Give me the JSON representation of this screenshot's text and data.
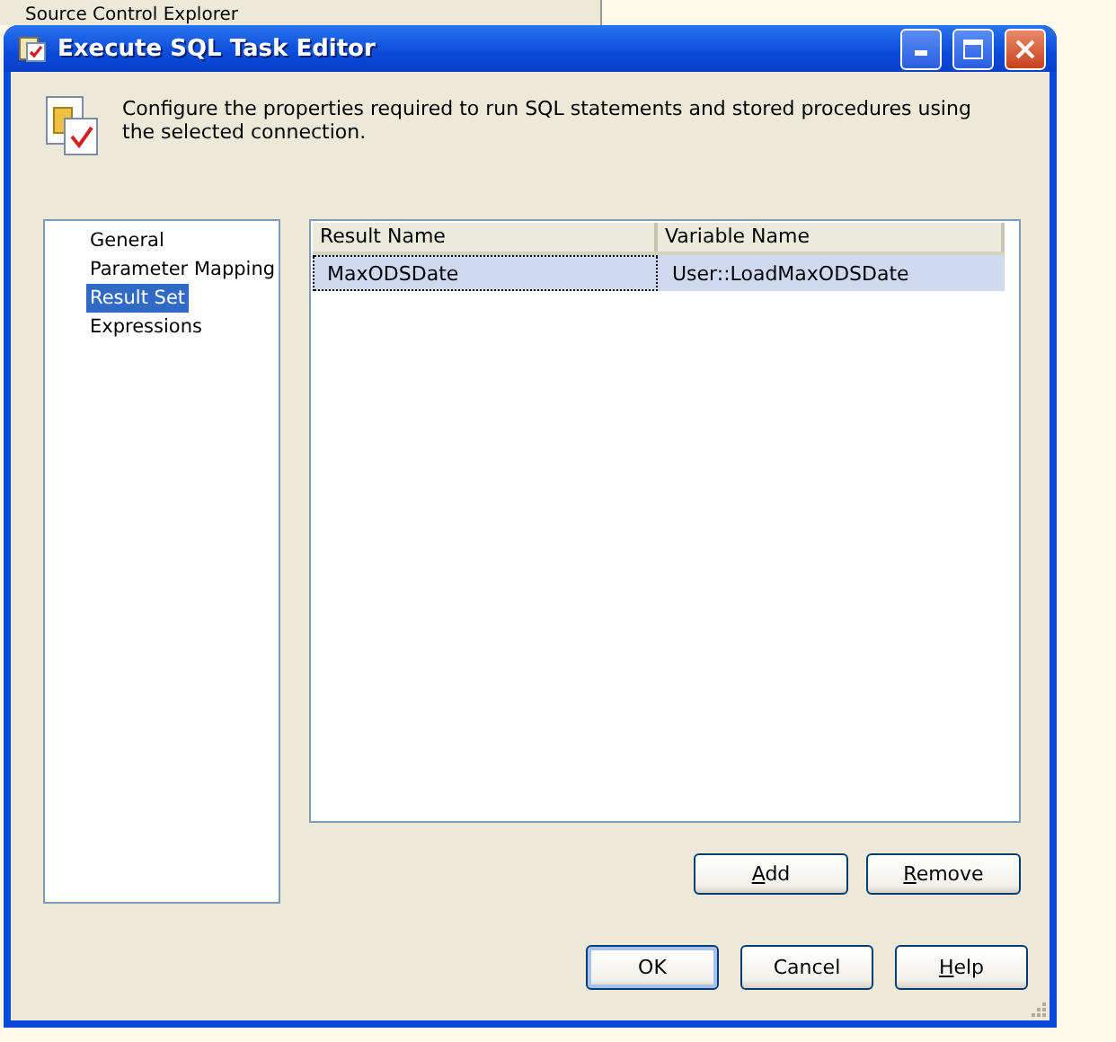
{
  "background": {
    "label": "Source Control Explorer"
  },
  "window": {
    "title": "Execute SQL Task Editor"
  },
  "description": "Configure the properties required to run SQL statements and stored procedures using the selected connection.",
  "nav": [
    {
      "label": "General",
      "selected": false
    },
    {
      "label": "Parameter Mapping",
      "selected": false
    },
    {
      "label": "Result Set",
      "selected": true
    },
    {
      "label": "Expressions",
      "selected": false
    }
  ],
  "table": {
    "columns": [
      "Result Name",
      "Variable Name"
    ],
    "rows": [
      {
        "cells": [
          "MaxODSDate",
          "User::LoadMaxODSDate"
        ],
        "selected": true
      }
    ]
  },
  "grid_buttons": [
    {
      "label": "Add",
      "mnemonic": true
    },
    {
      "label": "Remove",
      "mnemonic": true
    }
  ],
  "buttons": [
    {
      "label": "OK",
      "mnemonic": false,
      "default": true
    },
    {
      "label": "Cancel",
      "mnemonic": false,
      "default": false
    },
    {
      "label": "Help",
      "mnemonic": true,
      "default": false
    }
  ]
}
